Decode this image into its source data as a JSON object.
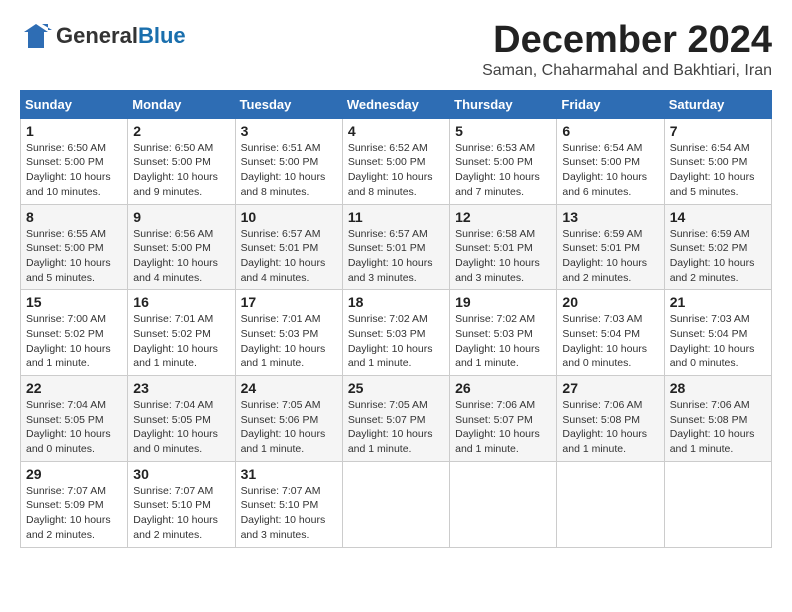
{
  "logo": {
    "general": "General",
    "blue": "Blue"
  },
  "title": "December 2024",
  "subtitle": "Saman, Chaharmahal and Bakhtiari, Iran",
  "weekdays": [
    "Sunday",
    "Monday",
    "Tuesday",
    "Wednesday",
    "Thursday",
    "Friday",
    "Saturday"
  ],
  "weeks": [
    [
      {
        "day": "1",
        "info": "Sunrise: 6:50 AM\nSunset: 5:00 PM\nDaylight: 10 hours\nand 10 minutes."
      },
      {
        "day": "2",
        "info": "Sunrise: 6:50 AM\nSunset: 5:00 PM\nDaylight: 10 hours\nand 9 minutes."
      },
      {
        "day": "3",
        "info": "Sunrise: 6:51 AM\nSunset: 5:00 PM\nDaylight: 10 hours\nand 8 minutes."
      },
      {
        "day": "4",
        "info": "Sunrise: 6:52 AM\nSunset: 5:00 PM\nDaylight: 10 hours\nand 8 minutes."
      },
      {
        "day": "5",
        "info": "Sunrise: 6:53 AM\nSunset: 5:00 PM\nDaylight: 10 hours\nand 7 minutes."
      },
      {
        "day": "6",
        "info": "Sunrise: 6:54 AM\nSunset: 5:00 PM\nDaylight: 10 hours\nand 6 minutes."
      },
      {
        "day": "7",
        "info": "Sunrise: 6:54 AM\nSunset: 5:00 PM\nDaylight: 10 hours\nand 5 minutes."
      }
    ],
    [
      {
        "day": "8",
        "info": "Sunrise: 6:55 AM\nSunset: 5:00 PM\nDaylight: 10 hours\nand 5 minutes."
      },
      {
        "day": "9",
        "info": "Sunrise: 6:56 AM\nSunset: 5:00 PM\nDaylight: 10 hours\nand 4 minutes."
      },
      {
        "day": "10",
        "info": "Sunrise: 6:57 AM\nSunset: 5:01 PM\nDaylight: 10 hours\nand 4 minutes."
      },
      {
        "day": "11",
        "info": "Sunrise: 6:57 AM\nSunset: 5:01 PM\nDaylight: 10 hours\nand 3 minutes."
      },
      {
        "day": "12",
        "info": "Sunrise: 6:58 AM\nSunset: 5:01 PM\nDaylight: 10 hours\nand 3 minutes."
      },
      {
        "day": "13",
        "info": "Sunrise: 6:59 AM\nSunset: 5:01 PM\nDaylight: 10 hours\nand 2 minutes."
      },
      {
        "day": "14",
        "info": "Sunrise: 6:59 AM\nSunset: 5:02 PM\nDaylight: 10 hours\nand 2 minutes."
      }
    ],
    [
      {
        "day": "15",
        "info": "Sunrise: 7:00 AM\nSunset: 5:02 PM\nDaylight: 10 hours\nand 1 minute."
      },
      {
        "day": "16",
        "info": "Sunrise: 7:01 AM\nSunset: 5:02 PM\nDaylight: 10 hours\nand 1 minute."
      },
      {
        "day": "17",
        "info": "Sunrise: 7:01 AM\nSunset: 5:03 PM\nDaylight: 10 hours\nand 1 minute."
      },
      {
        "day": "18",
        "info": "Sunrise: 7:02 AM\nSunset: 5:03 PM\nDaylight: 10 hours\nand 1 minute."
      },
      {
        "day": "19",
        "info": "Sunrise: 7:02 AM\nSunset: 5:03 PM\nDaylight: 10 hours\nand 1 minute."
      },
      {
        "day": "20",
        "info": "Sunrise: 7:03 AM\nSunset: 5:04 PM\nDaylight: 10 hours\nand 0 minutes."
      },
      {
        "day": "21",
        "info": "Sunrise: 7:03 AM\nSunset: 5:04 PM\nDaylight: 10 hours\nand 0 minutes."
      }
    ],
    [
      {
        "day": "22",
        "info": "Sunrise: 7:04 AM\nSunset: 5:05 PM\nDaylight: 10 hours\nand 0 minutes."
      },
      {
        "day": "23",
        "info": "Sunrise: 7:04 AM\nSunset: 5:05 PM\nDaylight: 10 hours\nand 0 minutes."
      },
      {
        "day": "24",
        "info": "Sunrise: 7:05 AM\nSunset: 5:06 PM\nDaylight: 10 hours\nand 1 minute."
      },
      {
        "day": "25",
        "info": "Sunrise: 7:05 AM\nSunset: 5:07 PM\nDaylight: 10 hours\nand 1 minute."
      },
      {
        "day": "26",
        "info": "Sunrise: 7:06 AM\nSunset: 5:07 PM\nDaylight: 10 hours\nand 1 minute."
      },
      {
        "day": "27",
        "info": "Sunrise: 7:06 AM\nSunset: 5:08 PM\nDaylight: 10 hours\nand 1 minute."
      },
      {
        "day": "28",
        "info": "Sunrise: 7:06 AM\nSunset: 5:08 PM\nDaylight: 10 hours\nand 1 minute."
      }
    ],
    [
      {
        "day": "29",
        "info": "Sunrise: 7:07 AM\nSunset: 5:09 PM\nDaylight: 10 hours\nand 2 minutes."
      },
      {
        "day": "30",
        "info": "Sunrise: 7:07 AM\nSunset: 5:10 PM\nDaylight: 10 hours\nand 2 minutes."
      },
      {
        "day": "31",
        "info": "Sunrise: 7:07 AM\nSunset: 5:10 PM\nDaylight: 10 hours\nand 3 minutes."
      },
      null,
      null,
      null,
      null
    ]
  ]
}
